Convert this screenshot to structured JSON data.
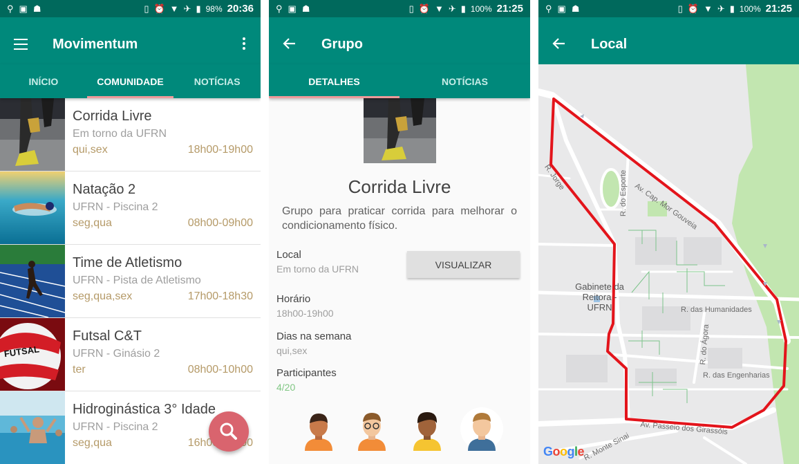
{
  "panel1": {
    "status": {
      "battery": "98%",
      "time": "20:36"
    },
    "title": "Movimentum",
    "tabs": [
      {
        "label": "INÍCIO",
        "active": false
      },
      {
        "label": "COMUNIDADE",
        "active": true
      },
      {
        "label": "NOTÍCIAS",
        "active": false
      }
    ],
    "groups": [
      {
        "title": "Corrida Livre",
        "location": "Em torno da UFRN",
        "days": "qui,sex",
        "time": "18h00-19h00",
        "image": "running-shoes"
      },
      {
        "title": "Natação 2",
        "location": "UFRN - Piscina 2",
        "days": "seg,qua",
        "time": "08h00-09h00",
        "image": "swimmer"
      },
      {
        "title": "Time de Atletismo",
        "location": "UFRN - Pista de Atletismo",
        "days": "seg,qua,sex",
        "time": "17h00-18h30",
        "image": "track-runner"
      },
      {
        "title": "Futsal C&T",
        "location": "UFRN - Ginásio 2",
        "days": "ter",
        "time": "08h00-10h00",
        "image": "futsal-ball"
      },
      {
        "title": "Hidroginástica 3° Idade",
        "location": "UFRN - Piscina 2",
        "days": "seg,qua",
        "time": "16h00-17h00",
        "image": "water-aerobics"
      }
    ],
    "fab_icon": "search-icon"
  },
  "panel2": {
    "status": {
      "battery": "100%",
      "time": "21:25"
    },
    "title": "Grupo",
    "tabs": [
      {
        "label": "DETALHES",
        "active": true
      },
      {
        "label": "NOTÍCIAS",
        "active": false
      }
    ],
    "group_name": "Corrida Livre",
    "description": "Grupo para praticar corrida para melhorar o condicionamento físico.",
    "local_label": "Local",
    "local_value": "Em torno da UFRN",
    "view_button": "VISUALIZAR",
    "schedule_label": "Horário",
    "schedule_value": "18h00-19h00",
    "days_label": "Dias na semana",
    "days_value": "qui,sex",
    "participants_label": "Participantes",
    "participants_value": "4/20",
    "participant_avatars": [
      "avatar-boy-orange",
      "avatar-boy-glasses",
      "avatar-boy-curly",
      "avatar-boy-blue"
    ]
  },
  "panel3": {
    "status": {
      "battery": "100%",
      "time": "21:25"
    },
    "title": "Local",
    "map_labels": {
      "street1": "Av. Cap. Mor Gouveia",
      "street2": "R. do Esporte",
      "poi": "Gabinete da Reitora - UFRN",
      "street3": "R. das Humanidades",
      "street4": "R. do Ágora",
      "street5": "R. das Engenharias",
      "street6": "Av. Passeio dos Girassóis",
      "street7": "R. Monte Sinai",
      "street8": "R. Jorge"
    },
    "google": "Google",
    "route_color": "#e3141b"
  }
}
